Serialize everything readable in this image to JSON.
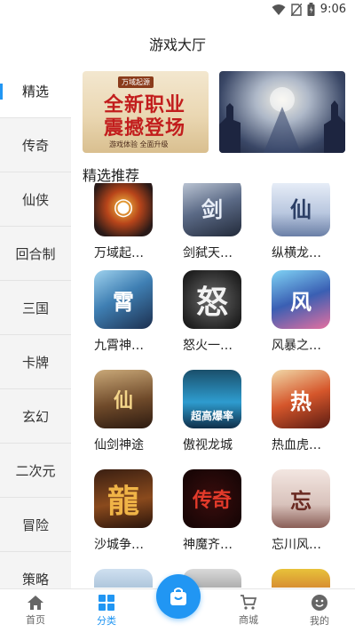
{
  "status_bar": {
    "time": "9:06",
    "icons": [
      "wifi-icon",
      "no-sim-icon",
      "battery-icon"
    ]
  },
  "header": {
    "title": "游戏大厅"
  },
  "sidebar": {
    "active_index": 0,
    "items": [
      {
        "label": "精选"
      },
      {
        "label": "传奇"
      },
      {
        "label": "仙侠"
      },
      {
        "label": "回合制"
      },
      {
        "label": "三国"
      },
      {
        "label": "卡牌"
      },
      {
        "label": "玄幻"
      },
      {
        "label": "二次元"
      },
      {
        "label": "冒险"
      },
      {
        "label": "策略"
      }
    ]
  },
  "banners": [
    {
      "brand": "万域起源",
      "headline_1": "全新职业",
      "headline_2": "震撼登场",
      "sub": "游戏体验 全面升级"
    },
    {
      "brand": "",
      "headline_1": "",
      "headline_2": "",
      "sub": ""
    }
  ],
  "section": {
    "title": "精选推荐"
  },
  "games": [
    {
      "name": "万域起…",
      "glyph": "◉"
    },
    {
      "name": "剑弑天…",
      "glyph": "剑"
    },
    {
      "name": "纵横龙…",
      "glyph": "仙"
    },
    {
      "name": "九霄神…",
      "glyph": "霄"
    },
    {
      "name": "怒火一…",
      "glyph": "怒"
    },
    {
      "name": "风暴之…",
      "glyph": "风"
    },
    {
      "name": "仙剑神途",
      "glyph": "仙"
    },
    {
      "name": "傲视龙城",
      "glyph": "超高爆率"
    },
    {
      "name": "热血虎…",
      "glyph": "热"
    },
    {
      "name": "沙城争…",
      "glyph": "龍"
    },
    {
      "name": "神魔齐…",
      "glyph": "传奇"
    },
    {
      "name": "忘川风…",
      "glyph": "忘"
    },
    {
      "name": "",
      "glyph": ""
    },
    {
      "name": "",
      "glyph": ""
    },
    {
      "name": "",
      "glyph": ""
    }
  ],
  "bottom_nav": {
    "active_index": 1,
    "items": [
      {
        "label": "首页",
        "icon": "home-icon"
      },
      {
        "label": "分类",
        "icon": "category-icon"
      },
      {
        "label": "",
        "icon": "bag-icon"
      },
      {
        "label": "商城",
        "icon": "cart-icon"
      },
      {
        "label": "我的",
        "icon": "profile-icon"
      }
    ]
  },
  "colors": {
    "accent": "#2196f3",
    "sidebar_bg": "#f4f4f4",
    "banner_red": "#c21d1d"
  }
}
